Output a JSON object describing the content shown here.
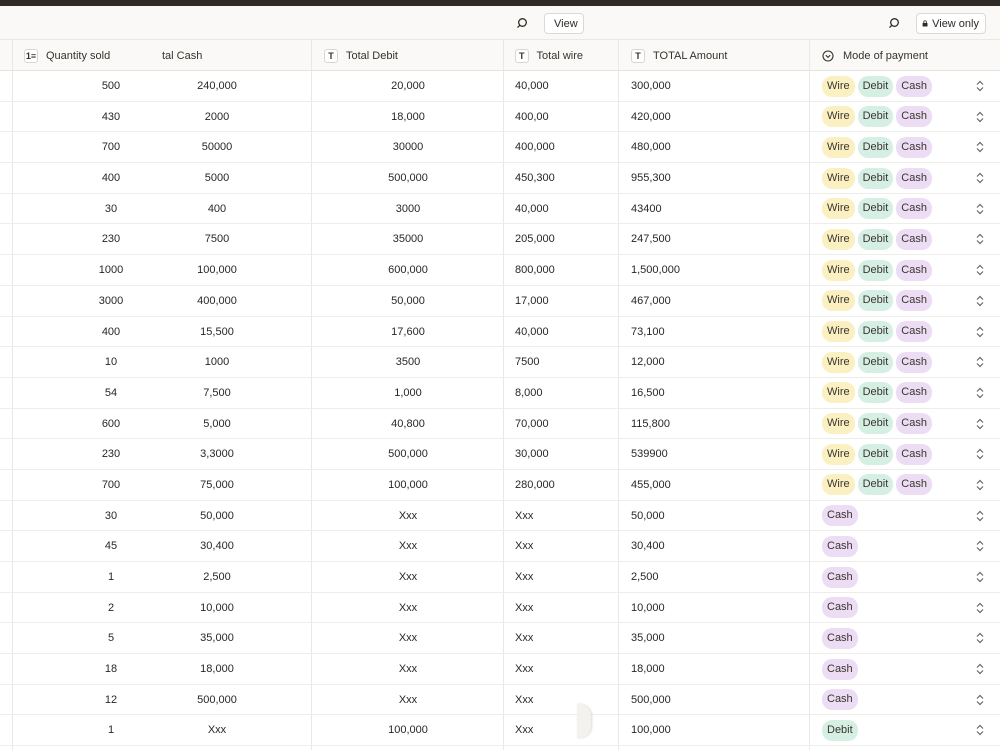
{
  "toolbar": {
    "view_label_left": "View",
    "view_label_right": "View only"
  },
  "columns": {
    "quantity": "Quantity sold",
    "cash": "tal Cash",
    "debit": "Total Debit",
    "wire": "Total wire",
    "total": "TOTAL Amount",
    "mode": "Mode of payment"
  },
  "icons": {
    "quantity_header": "number-list-icon",
    "text_header": "text-type-icon",
    "mode_header": "select-circle-icon",
    "search": "search-icon",
    "lock": "lock-icon",
    "sort": "chevron-up-down-icon"
  },
  "colors": {
    "wire": "#fbf0c1",
    "debit": "#d6efe5",
    "cash": "#ecdcf4"
  },
  "rows": [
    {
      "qty": "500",
      "cash": "240,000",
      "debit": "20,000",
      "wire": "40,000",
      "total": "300,000",
      "modes": [
        "Wire",
        "Debit",
        "Cash"
      ]
    },
    {
      "qty": "430",
      "cash": "2000",
      "debit": "18,000",
      "wire": "400,00",
      "total": "420,000",
      "modes": [
        "Wire",
        "Debit",
        "Cash"
      ]
    },
    {
      "qty": "700",
      "cash": "50000",
      "debit": "30000",
      "wire": "400,000",
      "total": "480,000",
      "modes": [
        "Wire",
        "Debit",
        "Cash"
      ]
    },
    {
      "qty": "400",
      "cash": "5000",
      "debit": "500,000",
      "wire": "450,300",
      "total": "955,300",
      "modes": [
        "Wire",
        "Debit",
        "Cash"
      ]
    },
    {
      "qty": "30",
      "cash": "400",
      "debit": "3000",
      "wire": "40,000",
      "total": "43400",
      "modes": [
        "Wire",
        "Debit",
        "Cash"
      ]
    },
    {
      "qty": "230",
      "cash": "7500",
      "debit": "35000",
      "wire": "205,000",
      "total": "247,500",
      "modes": [
        "Wire",
        "Debit",
        "Cash"
      ]
    },
    {
      "qty": "1000",
      "cash": "100,000",
      "debit": "600,000",
      "wire": "800,000",
      "total": "1,500,000",
      "modes": [
        "Wire",
        "Debit",
        "Cash"
      ]
    },
    {
      "qty": "3000",
      "cash": "400,000",
      "debit": "50,000",
      "wire": "17,000",
      "total": "467,000",
      "modes": [
        "Wire",
        "Debit",
        "Cash"
      ]
    },
    {
      "qty": "400",
      "cash": "15,500",
      "debit": "17,600",
      "wire": "40,000",
      "total": "73,100",
      "modes": [
        "Wire",
        "Debit",
        "Cash"
      ]
    },
    {
      "qty": "10",
      "cash": "1000",
      "debit": "3500",
      "wire": "7500",
      "total": "12,000",
      "modes": [
        "Wire",
        "Debit",
        "Cash"
      ]
    },
    {
      "qty": "54",
      "cash": "7,500",
      "debit": "1,000",
      "wire": "8,000",
      "total": "16,500",
      "modes": [
        "Wire",
        "Debit",
        "Cash"
      ]
    },
    {
      "qty": "600",
      "cash": "5,000",
      "debit": "40,800",
      "wire": "70,000",
      "total": "115,800",
      "modes": [
        "Wire",
        "Debit",
        "Cash"
      ]
    },
    {
      "qty": "230",
      "cash": "3,3000",
      "debit": "500,000",
      "wire": "30,000",
      "total": "539900",
      "modes": [
        "Wire",
        "Debit",
        "Cash"
      ]
    },
    {
      "qty": "700",
      "cash": "75,000",
      "debit": "100,000",
      "wire": "280,000",
      "total": "455,000",
      "modes": [
        "Wire",
        "Debit",
        "Cash"
      ]
    },
    {
      "qty": "30",
      "cash": "50,000",
      "debit": "Xxx",
      "wire": "Xxx",
      "total": "50,000",
      "modes": [
        "Cash"
      ]
    },
    {
      "qty": "45",
      "cash": "30,400",
      "debit": "Xxx",
      "wire": "Xxx",
      "total": "30,400",
      "modes": [
        "Cash"
      ]
    },
    {
      "qty": "1",
      "cash": "2,500",
      "debit": "Xxx",
      "wire": "Xxx",
      "total": "2,500",
      "modes": [
        "Cash"
      ]
    },
    {
      "qty": "2",
      "cash": "10,000",
      "debit": "Xxx",
      "wire": "Xxx",
      "total": "10,000",
      "modes": [
        "Cash"
      ]
    },
    {
      "qty": "5",
      "cash": "35,000",
      "debit": "Xxx",
      "wire": "Xxx",
      "total": "35,000",
      "modes": [
        "Cash"
      ]
    },
    {
      "qty": "18",
      "cash": "18,000",
      "debit": "Xxx",
      "wire": "Xxx",
      "total": "18,000",
      "modes": [
        "Cash"
      ]
    },
    {
      "qty": "12",
      "cash": "500,000",
      "debit": "Xxx",
      "wire": "Xxx",
      "total": "500,000",
      "modes": [
        "Cash"
      ]
    },
    {
      "qty": "1",
      "cash": "Xxx",
      "debit": "100,000",
      "wire": "Xxx",
      "total": "100,000",
      "modes": [
        "Debit"
      ]
    }
  ]
}
